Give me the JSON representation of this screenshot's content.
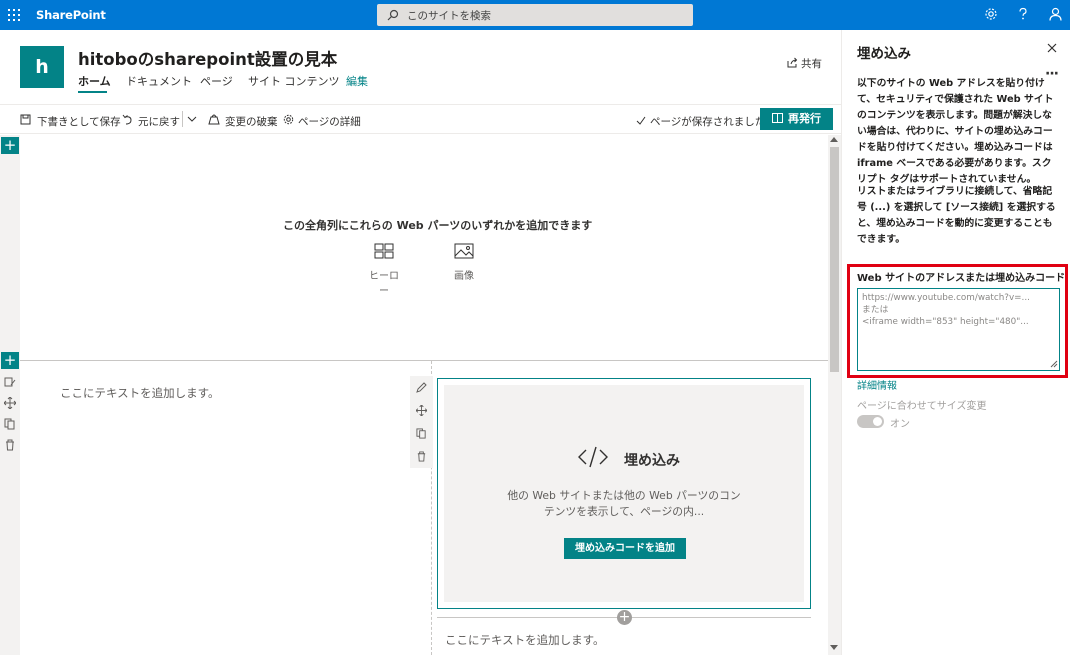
{
  "suite": {
    "brand": "SharePoint",
    "search_placeholder": "このサイトを検索"
  },
  "site": {
    "logo_letter": "h",
    "title": "hitoboのsharepoint設置の見本",
    "nav": [
      "ホーム",
      "ドキュメント",
      "ページ",
      "サイト コンテンツ",
      "編集"
    ],
    "share_label": "共有"
  },
  "commandbar": {
    "save_draft": "下書きとして保存",
    "undo": "元に戻す",
    "discard": "変更の破棄",
    "page_details": "ページの詳細",
    "saved_status": "ページが保存されました",
    "republish": "再発行"
  },
  "canvas": {
    "empty_hint": "この全角列にこれらの Web パーツのいずれかを追加できます",
    "options": [
      "ヒーロー",
      "画像"
    ],
    "text_placeholder": "ここにテキストを追加します。",
    "embed": {
      "title": "埋め込み",
      "description": "他の Web サイトまたは他の Web パーツのコンテンツを表示して、ページの内...",
      "button": "埋め込みコードを追加"
    }
  },
  "panel": {
    "title": "埋め込み",
    "paragraph1": "以下のサイトの Web アドレスを貼り付けて、セキュリティで保護された Web サイトのコンテンツを表示します。問題が解決しない場合は、代わりに、サイトの埋め込みコードを貼り付けてください。埋め込みコードは iframe ベースである必要があります。スクリプト タグはサポートされていません。",
    "paragraph2": "リストまたはライブラリに接続して、省略記号 (...) を選択して [ソース接続] を選択すると、埋め込みコードを動的に変更することもできます。",
    "field_label": "Web サイトのアドレスまたは埋め込みコード",
    "field_placeholder": "https://www.youtube.com/watch?v=...\nまたは\n<iframe width=\"853\" height=\"480\"...",
    "learn_more": "詳細情報",
    "resize_label": "ページに合わせてサイズ変更",
    "toggle_label": "オン",
    "toggle_on": true
  },
  "colors": {
    "suite_bar": "#0078d4",
    "accent": "#038387",
    "highlight": "#e00012"
  }
}
